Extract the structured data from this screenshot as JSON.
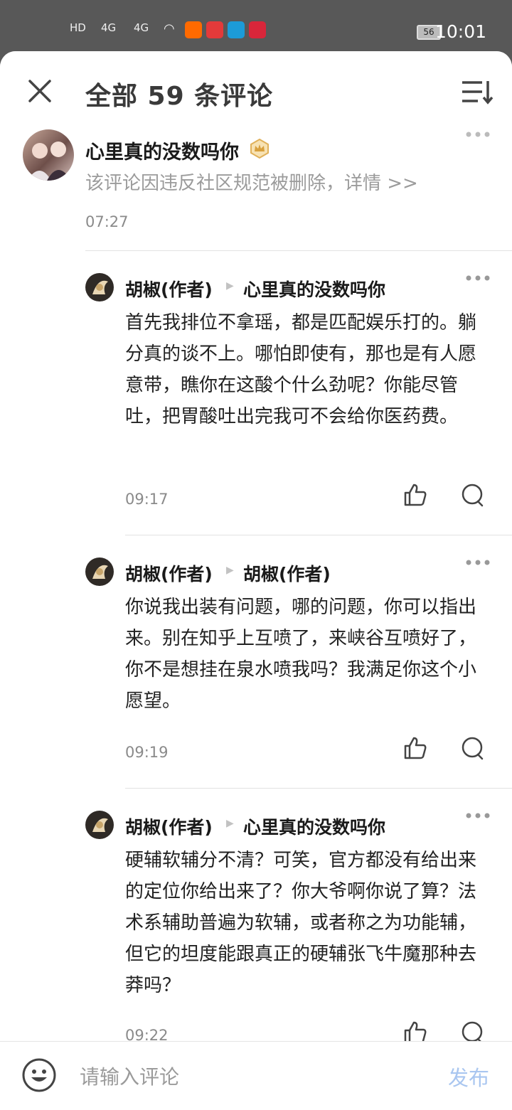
{
  "status_bar": {
    "hd": "HD",
    "signal1": "4G",
    "signal2": "4G",
    "battery": "56",
    "time": "10:01",
    "app_icons": [
      "taobao-icon",
      "tmall-icon",
      "delivery-icon",
      "huawei-icon"
    ]
  },
  "header": {
    "title": "全部 59 条评论"
  },
  "comments": [
    {
      "author": "心里真的没数吗你",
      "text": "该评论因违反社区规范被删除，详情 >>",
      "time": "07:27",
      "badge": "crown-badge-icon"
    },
    {
      "author": "胡椒(作者)",
      "reply_to": "心里真的没数吗你",
      "text": "首先我排位不拿瑶，都是匹配娱乐打的。躺分真的谈不上。哪怕即使有，那也是有人愿意带，瞧你在这酸个什么劲呢？你能尽管吐，把胃酸吐出完我可不会给你医药费。",
      "time": "09:17"
    },
    {
      "author": "胡椒(作者)",
      "reply_to": "胡椒(作者)",
      "text": "你说我出装有问题，哪的问题，你可以指出来。别在知乎上互喷了，来峡谷互喷好了，你不是想挂在泉水喷我吗？我满足你这个小愿望。",
      "time": "09:19"
    },
    {
      "author": "胡椒(作者)",
      "reply_to": "心里真的没数吗你",
      "text": "硬辅软辅分不清？可笑，官方都没有给出来的定位你给出来了？你大爷啊你说了算？法术系辅助普遍为软辅，或者称之为功能辅，但它的坦度能跟真正的硬辅张飞牛魔那种去莽吗？",
      "time": "09:22"
    }
  ],
  "bottom": {
    "placeholder": "请输入评论",
    "publish": "发布"
  },
  "colors": {
    "publish": "#a9c6f0",
    "text": "#222222",
    "muted": "#8a8a8a"
  }
}
